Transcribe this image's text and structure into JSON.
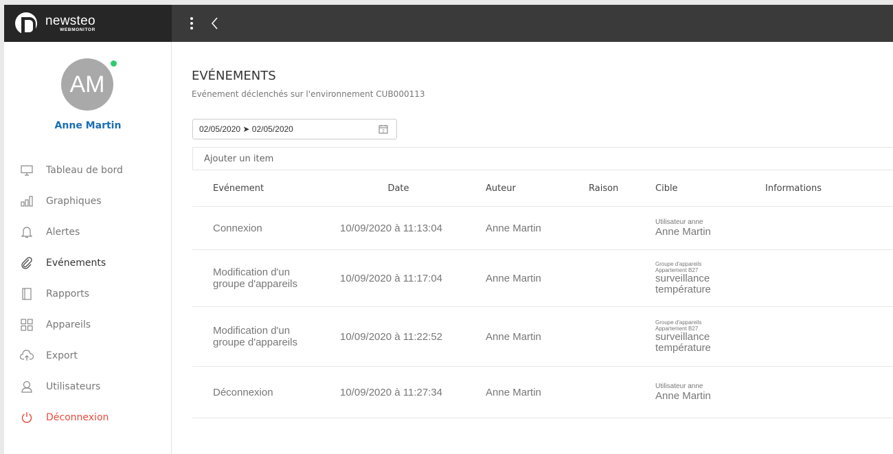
{
  "app": {
    "brand_name": "newsteo",
    "brand_sub": "WEBMONITOR"
  },
  "user": {
    "initials": "AM",
    "name": "Anne Martin",
    "status_color": "#2ecc71"
  },
  "sidebar": {
    "items": [
      {
        "label": "Tableau de bord",
        "icon": "monitor-icon"
      },
      {
        "label": "Graphiques",
        "icon": "bar-chart-icon"
      },
      {
        "label": "Alertes",
        "icon": "bell-icon"
      },
      {
        "label": "Evénements",
        "icon": "paperclip-icon",
        "active": true
      },
      {
        "label": "Rapports",
        "icon": "document-icon"
      },
      {
        "label": "Appareils",
        "icon": "grid-icon"
      },
      {
        "label": "Export",
        "icon": "cloud-upload-icon"
      },
      {
        "label": "Utilisateurs",
        "icon": "user-icon"
      },
      {
        "label": "Déconnexion",
        "icon": "power-icon",
        "danger": true
      }
    ]
  },
  "page": {
    "title": "EVÉNEMENTS",
    "subtitle": "Evénement déclenchés sur l'environnement CUB000113",
    "date_range": "02/05/2020 ➤ 02/05/2020",
    "add_item": "Ajouter un item"
  },
  "table": {
    "headers": [
      "Evénement",
      "Date",
      "Auteur",
      "Raison",
      "Cible",
      "Informations"
    ],
    "rows": [
      {
        "event": [
          "Connexion"
        ],
        "date": "10/09/2020 à 11:13:04",
        "author": "Anne Martin",
        "reason": "",
        "target_small": [
          "Utilisateur anne"
        ],
        "target_big": [
          "Anne Martin"
        ],
        "info": ""
      },
      {
        "event": [
          "Modification d'un",
          "groupe d'appareils"
        ],
        "date": "10/09/2020 à 11:17:04",
        "author": "Anne Martin",
        "reason": "",
        "target_small": [
          "Groupe d'appareils",
          "Appartement B27"
        ],
        "target_big": [
          "surveillance",
          "température"
        ],
        "info": ""
      },
      {
        "event": [
          "Modification d'un",
          "groupe d'appareils"
        ],
        "date": "10/09/2020 à 11:22:52",
        "author": "Anne Martin",
        "reason": "",
        "target_small": [
          "Groupe d'appareils",
          "Appartement B27"
        ],
        "target_big": [
          "surveillance",
          "température"
        ],
        "info": ""
      },
      {
        "event": [
          "Déconnexion"
        ],
        "date": "10/09/2020 à 11:27:34",
        "author": "Anne Martin",
        "reason": "",
        "target_small": [
          "Utilisateur anne"
        ],
        "target_big": [
          "Anne Martin"
        ],
        "info": ""
      }
    ]
  }
}
